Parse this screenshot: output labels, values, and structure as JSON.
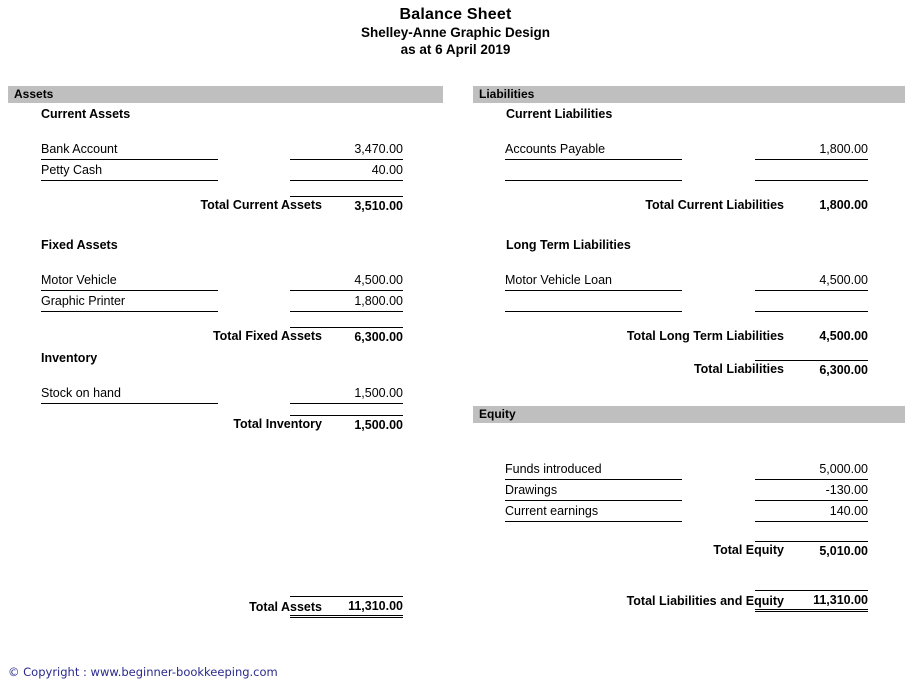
{
  "document": {
    "title": "Balance Sheet",
    "company": "Shelley-Anne Graphic Design",
    "date_line": "as at 6 April 2019"
  },
  "colors": {
    "section_bar": "#bfbfbf",
    "footer_text": "#2a2a8c",
    "rule": "#000000"
  },
  "assets": {
    "header": "Assets",
    "groups": {
      "current": {
        "heading": "Current Assets",
        "lines": [
          {
            "label": "Bank Account",
            "amount": "3,470.00"
          },
          {
            "label": "Petty Cash",
            "amount": "40.00"
          }
        ],
        "total": {
          "label": "Total Current Assets",
          "amount": "3,510.00"
        }
      },
      "fixed": {
        "heading": "Fixed Assets",
        "lines": [
          {
            "label": "Motor Vehicle",
            "amount": "4,500.00"
          },
          {
            "label": "Graphic Printer",
            "amount": "1,800.00"
          }
        ],
        "total": {
          "label": "Total Fixed Assets",
          "amount": "6,300.00"
        }
      },
      "inventory": {
        "heading": "Inventory",
        "lines": [
          {
            "label": "Stock on hand",
            "amount": "1,500.00"
          }
        ],
        "total": {
          "label": "Total Inventory",
          "amount": "1,500.00"
        }
      }
    },
    "grand_total": {
      "label": "Total Assets",
      "amount": "11,310.00"
    }
  },
  "liabilities": {
    "header": "Liabilities",
    "groups": {
      "current": {
        "heading": "Current Liabilities",
        "lines": [
          {
            "label": "Accounts Payable",
            "amount": "1,800.00"
          },
          {
            "label": "",
            "amount": ""
          }
        ],
        "total": {
          "label": "Total Current Liabilities",
          "amount": "1,800.00"
        }
      },
      "long_term": {
        "heading": "Long Term Liabilities",
        "lines": [
          {
            "label": "Motor Vehicle Loan",
            "amount": "4,500.00"
          },
          {
            "label": "",
            "amount": ""
          }
        ],
        "total": {
          "label": "Total Long Term Liabilities",
          "amount": "4,500.00"
        }
      }
    },
    "total": {
      "label": "Total Liabilities",
      "amount": "6,300.00"
    }
  },
  "equity": {
    "header": "Equity",
    "lines": [
      {
        "label": "Funds introduced",
        "amount": "5,000.00"
      },
      {
        "label": "Drawings",
        "amount": "-130.00"
      },
      {
        "label": "Current earnings",
        "amount": "140.00"
      }
    ],
    "total": {
      "label": "Total Equity",
      "amount": "5,010.00"
    }
  },
  "grand_total_right": {
    "label": "Total Liabilities and Equity",
    "amount": "11,310.00"
  },
  "footer": {
    "text": "© Copyright : www.beginner-bookkeeping.com"
  }
}
